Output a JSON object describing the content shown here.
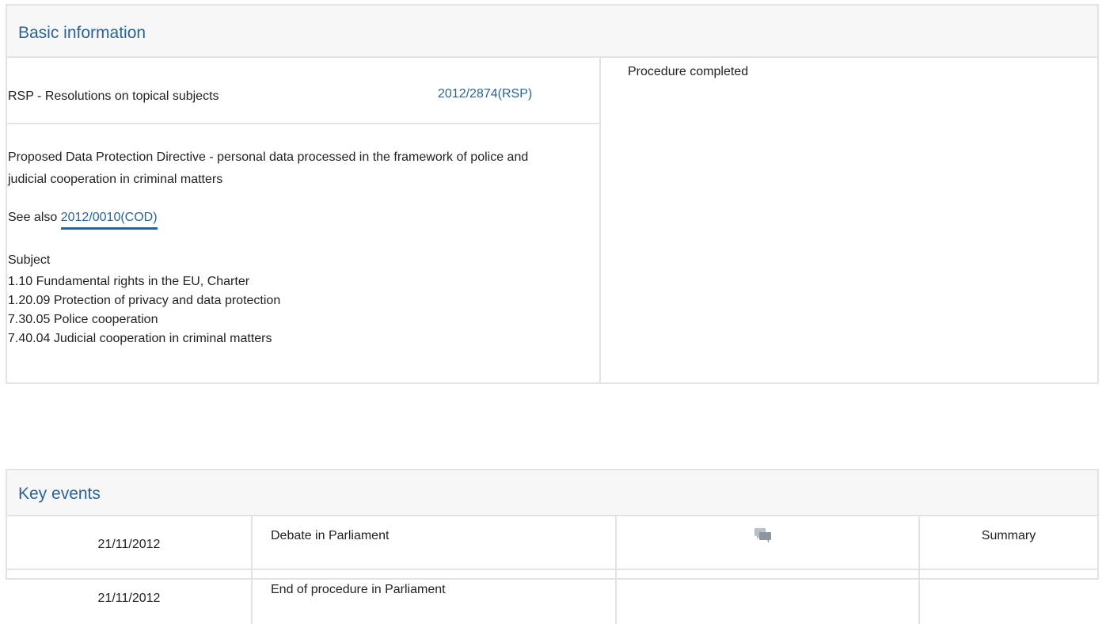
{
  "basic_info": {
    "title": "Basic information",
    "procedure_type": "RSP - Resolutions on topical subjects",
    "procedure_reference": "2012/2874(RSP)",
    "status": "Procedure completed",
    "procedure_title": "Proposed Data Protection Directive - personal data processed in the framework of police and judicial cooperation in criminal matters",
    "see_also_label": "See also",
    "see_also_link": "2012/0010(COD)",
    "subject_label": "Subject",
    "subjects": [
      "1.10 Fundamental rights in the EU, Charter",
      "1.20.09 Protection of privacy and data protection",
      "7.30.05 Police cooperation",
      "7.40.04 Judicial cooperation in criminal matters"
    ]
  },
  "key_events": {
    "title": "Key events",
    "rows": [
      {
        "date": "21/11/2012",
        "event": "Debate in Parliament",
        "icon": "debate-icon",
        "summary": "Summary"
      },
      {
        "date": "21/11/2012",
        "event": "End of procedure in Parliament",
        "summary": ""
      }
    ]
  },
  "colors": {
    "link": "#2a6496",
    "border": "#e3e3e3",
    "header_bg": "#f7f7f7"
  }
}
